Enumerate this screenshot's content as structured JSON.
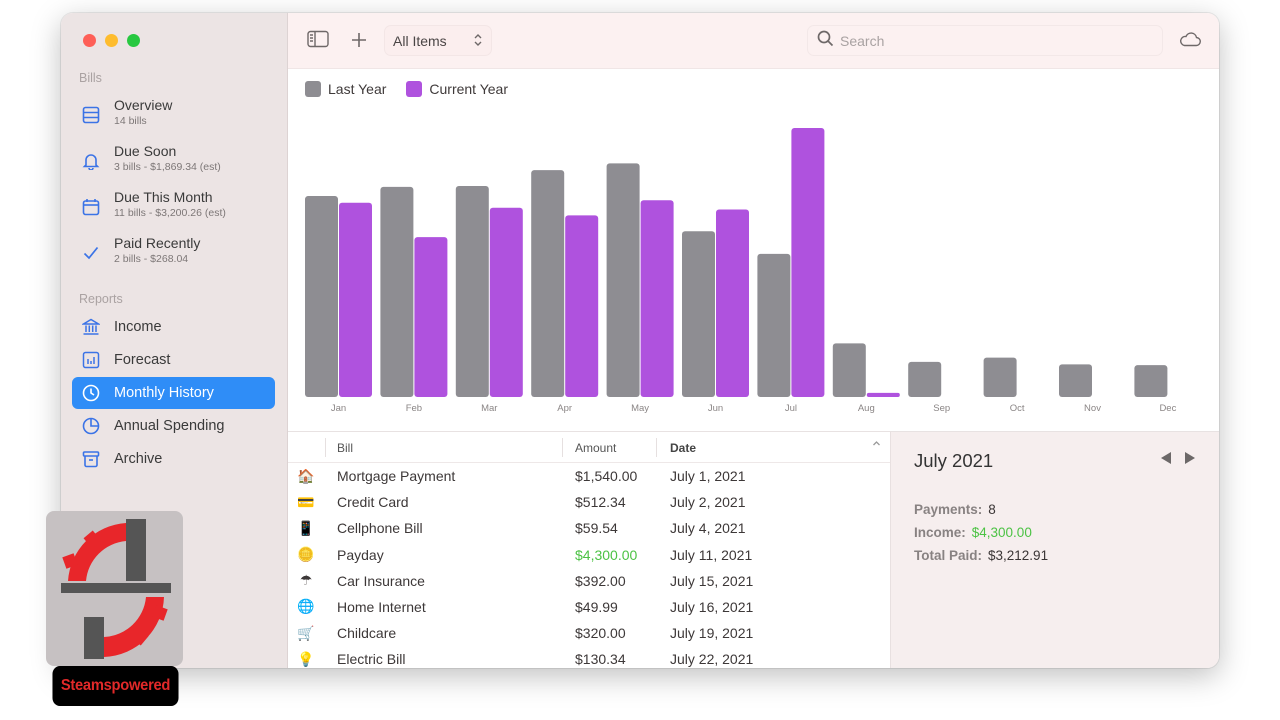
{
  "window": {
    "traffic_lights": [
      "close",
      "minimize",
      "zoom"
    ]
  },
  "sidebar": {
    "sections": [
      {
        "label": "Bills",
        "items": [
          {
            "icon": "list-icon",
            "title": "Overview",
            "subtitle": "14 bills"
          },
          {
            "icon": "bell-icon",
            "title": "Due Soon",
            "subtitle": "3 bills - $1,869.34 (est)"
          },
          {
            "icon": "calendar-icon",
            "title": "Due This Month",
            "subtitle": "11 bills - $3,200.26 (est)"
          },
          {
            "icon": "checkmark-icon",
            "title": "Paid Recently",
            "subtitle": "2 bills - $268.04"
          }
        ]
      },
      {
        "label": "Reports",
        "items": [
          {
            "icon": "bank-icon",
            "title": "Income"
          },
          {
            "icon": "chart-icon",
            "title": "Forecast"
          },
          {
            "icon": "clock-icon",
            "title": "Monthly History",
            "active": true
          },
          {
            "icon": "pie-icon",
            "title": "Annual Spending"
          },
          {
            "icon": "archive-icon",
            "title": "Archive"
          }
        ]
      }
    ]
  },
  "toolbar": {
    "sidebar_toggle_icon": "sidebar-icon",
    "add_icon": "plus-icon",
    "filter_value": "All Items",
    "search_placeholder": "Search",
    "search_value": "",
    "sync_icon": "cloud-icon"
  },
  "chart_data": {
    "type": "bar",
    "title": "",
    "xlabel": "",
    "ylabel": "",
    "grid": false,
    "legend_position": "top-left",
    "categories": [
      "Jan",
      "Feb",
      "Mar",
      "Apr",
      "May",
      "Jun",
      "Jul",
      "Aug",
      "Sep",
      "Oct",
      "Nov",
      "Dec"
    ],
    "series": [
      {
        "name": "Last Year",
        "color": "#8e8d92",
        "values": [
          2400,
          2510,
          2520,
          2710,
          2790,
          1980,
          1710,
          640,
          420,
          470,
          390,
          380
        ]
      },
      {
        "name": "Current Year",
        "color": "#af52de",
        "values": [
          2320,
          1910,
          2260,
          2170,
          2350,
          2240,
          3212.91,
          50,
          null,
          null,
          null,
          null
        ]
      }
    ],
    "ylim": [
      0,
      3300
    ]
  },
  "table": {
    "columns": [
      "Bill",
      "Amount",
      "Date"
    ],
    "sort_indicator": "chevron-up-icon",
    "rows": [
      {
        "icon": "house-icon",
        "glyph": "🏠",
        "bill": "Mortgage Payment",
        "amount": "$1,540.00",
        "date": "July 1, 2021",
        "income": false
      },
      {
        "icon": "credit-card-icon",
        "glyph": "💳",
        "bill": "Credit Card",
        "amount": "$512.34",
        "date": "July 2, 2021",
        "income": false
      },
      {
        "icon": "phone-icon",
        "glyph": "📱",
        "bill": "Cellphone Bill",
        "amount": "$59.54",
        "date": "July 4, 2021",
        "income": false
      },
      {
        "icon": "coins-icon",
        "glyph": "🪙",
        "bill": "Payday",
        "amount": "$4,300.00",
        "date": "July 11, 2021",
        "income": true
      },
      {
        "icon": "umbrella-icon",
        "glyph": "☂",
        "bill": "Car Insurance",
        "amount": "$392.00",
        "date": "July 15, 2021",
        "income": false
      },
      {
        "icon": "globe-icon",
        "glyph": "🌐",
        "bill": "Home Internet",
        "amount": "$49.99",
        "date": "July 16, 2021",
        "income": false
      },
      {
        "icon": "stroller-icon",
        "glyph": "🛒",
        "bill": "Childcare",
        "amount": "$320.00",
        "date": "July 19, 2021",
        "income": false
      },
      {
        "icon": "lightbulb-icon",
        "glyph": "💡",
        "bill": "Electric Bill",
        "amount": "$130.34",
        "date": "July 22, 2021",
        "income": false
      }
    ]
  },
  "detail": {
    "month": "July 2021",
    "payments_label": "Payments:",
    "payments_value": "8",
    "income_label": "Income:",
    "income_value": "$4,300.00",
    "total_label": "Total Paid:",
    "total_value": "$3,212.91",
    "prev_icon": "triangle-left-icon",
    "next_icon": "triangle-right-icon"
  },
  "colors": {
    "accent": "#2f8df7",
    "last_year": "#8e8d92",
    "current_year": "#af52de",
    "income_green": "#4cc244",
    "icon_blue": "#3b73e6"
  },
  "watermark": {
    "label": "Steamspowered"
  }
}
